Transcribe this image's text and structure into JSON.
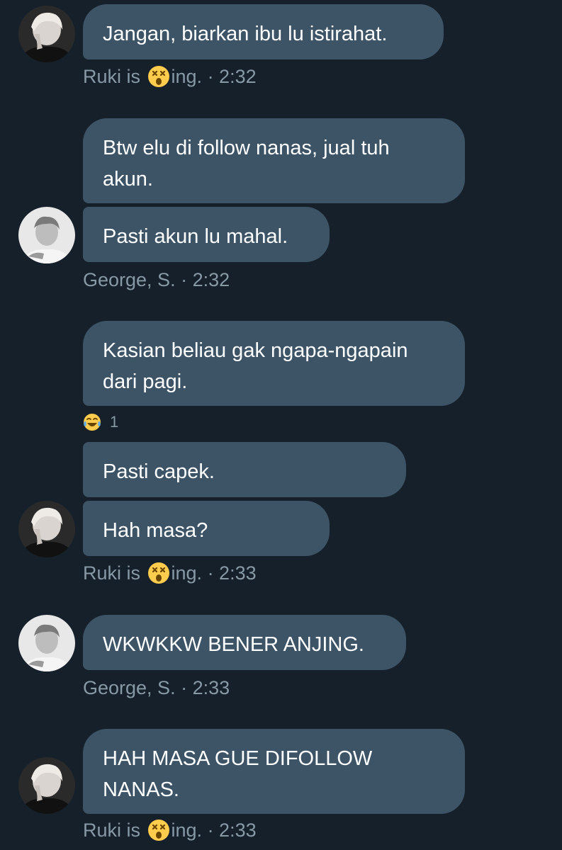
{
  "colors": {
    "background": "#15202b",
    "bubble": "#3d5466",
    "meta_text": "#8899a6"
  },
  "icons": {
    "status_emoji": "dizzy-face-icon",
    "reaction_emoji": "tears-of-joy-icon"
  },
  "messages": [
    {
      "text": "Jangan, biarkan ibu lu istirahat."
    },
    {
      "meta_name": "Ruki is",
      "meta_suffix": "ing. · 2:32"
    },
    {
      "text": "Btw elu di follow nanas, jual tuh\nakun."
    },
    {
      "text": "Pasti akun lu mahal."
    },
    {
      "meta_name": "George, S. · 2:32"
    },
    {
      "text": "Kasian beliau gak ngapa-ngapain\ndari pagi."
    },
    {
      "reaction_count": "1"
    },
    {
      "text": "Pasti capek."
    },
    {
      "text": "Hah masa?"
    },
    {
      "meta_name": "Ruki is",
      "meta_suffix": "ing. · 2:33"
    },
    {
      "text": "WKWKKW BENER ANJING."
    },
    {
      "meta_name": "George, S. · 2:33"
    },
    {
      "text": "HAH MASA GUE DIFOLLOW\nNANAS."
    },
    {
      "meta_name": "Ruki is",
      "meta_suffix": "ing. · 2:33"
    }
  ]
}
